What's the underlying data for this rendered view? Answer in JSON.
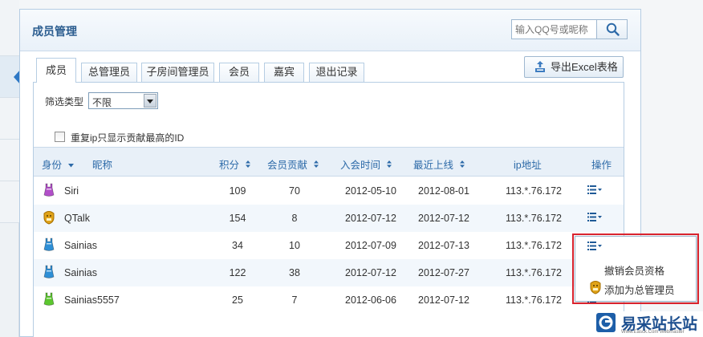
{
  "panel": {
    "title": "成员管理"
  },
  "search": {
    "placeholder": "输入QQ号或昵称"
  },
  "tabs": [
    {
      "label": "成员",
      "active": true
    },
    {
      "label": "总管理员",
      "active": false
    },
    {
      "label": "子房间管理员",
      "active": false
    },
    {
      "label": "会员",
      "active": false
    },
    {
      "label": "嘉宾",
      "active": false
    },
    {
      "label": "退出记录",
      "active": false
    }
  ],
  "export": {
    "label": "导出Excel表格"
  },
  "filter": {
    "label": "筛选类型",
    "selected": "不限"
  },
  "dedupe": {
    "label": "重复ip只显示贡献最高的ID",
    "checked": false
  },
  "table": {
    "columns": {
      "role": "身份",
      "nickname": "昵称",
      "points": "积分",
      "contribution": "会员贡献",
      "join_time": "入会时间",
      "last_online": "最近上线",
      "ip": "ip地址",
      "actions": "操作"
    },
    "rows": [
      {
        "icon": "purple-member-icon",
        "nickname": "Siri",
        "points": "109",
        "contribution": "70",
        "join_time": "2012-05-10",
        "last_online": "2012-08-01",
        "ip": "113.*.76.172"
      },
      {
        "icon": "gold-admin-icon",
        "nickname": "QTalk",
        "points": "154",
        "contribution": "8",
        "join_time": "2012-07-12",
        "last_online": "2012-07-12",
        "ip": "113.*.76.172"
      },
      {
        "icon": "blue-member-icon",
        "nickname": "Sainias",
        "points": "34",
        "contribution": "10",
        "join_time": "2012-07-09",
        "last_online": "2012-07-13",
        "ip": "113.*.76.172"
      },
      {
        "icon": "blue-member-icon",
        "nickname": "Sainias",
        "points": "122",
        "contribution": "38",
        "join_time": "2012-07-12",
        "last_online": "2012-07-27",
        "ip": "113.*.76.172"
      },
      {
        "icon": "green-member-icon",
        "nickname": "Sainias5557",
        "points": "25",
        "contribution": "7",
        "join_time": "2012-06-06",
        "last_online": "2012-07-12",
        "ip": "113.*.76.172"
      }
    ]
  },
  "action_menu": {
    "items": [
      "撤销会员资格",
      "添加为总管理员"
    ]
  },
  "watermark": {
    "text": "易采站长站",
    "sub": "Www.Easck.Com Webmaster"
  },
  "colors": {
    "accent": "#2d6aa8",
    "header_bg": "#e8f0f8",
    "highlight": "#d9232e",
    "purple": "#b24fc9",
    "gold": "#e0a319",
    "blue": "#2e8fd6",
    "green": "#5cc72f"
  }
}
